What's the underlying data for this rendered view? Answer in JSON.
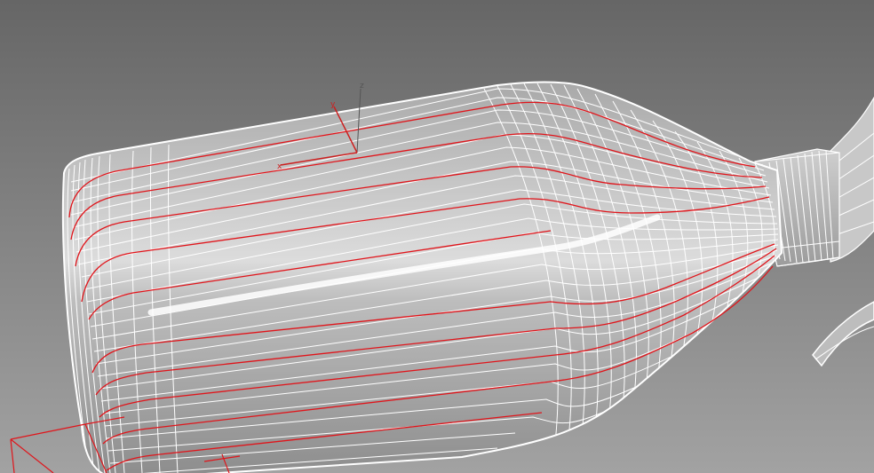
{
  "viewport": {
    "background_top": "#666666",
    "background_bottom": "#9a9a9a"
  },
  "gizmo": {
    "z_label": "z",
    "y_label": "y",
    "x_label": "x",
    "z_color": "#555555",
    "y_color": "#cc1f1f",
    "x_color": "#cc1f1f"
  },
  "model": {
    "wire_color": "#ffffff",
    "curve_color": "#e0151b",
    "shade_color": "#b8b8b8"
  }
}
